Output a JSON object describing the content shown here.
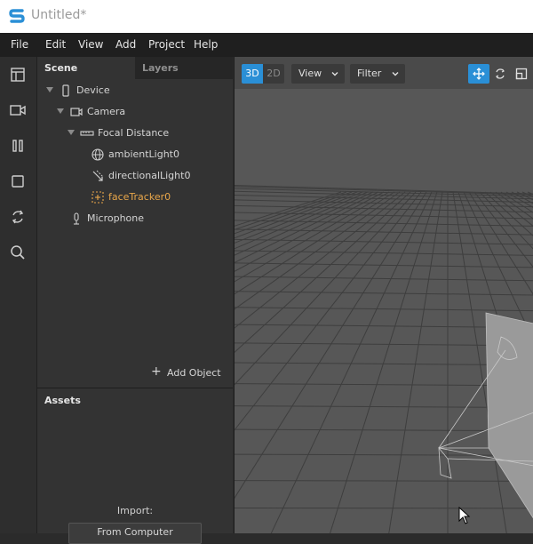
{
  "window": {
    "title": "Untitled*"
  },
  "menu": [
    "File",
    "Edit",
    "View",
    "Add",
    "Project",
    "Help"
  ],
  "rail_icons": [
    "layout-icon",
    "video-camera-icon",
    "pause-icon",
    "square-icon",
    "sync-icon",
    "search-icon"
  ],
  "scene": {
    "tabs": {
      "scene": "Scene",
      "layers": "Layers"
    },
    "tree": [
      {
        "label": "Device",
        "icon": "device-icon",
        "expanded": true
      },
      {
        "label": "Camera",
        "icon": "camera-icon",
        "expanded": true
      },
      {
        "label": "Focal Distance",
        "icon": "focal-distance-icon",
        "expanded": true
      },
      {
        "label": "ambientLight0",
        "icon": "globe-icon",
        "expanded": false
      },
      {
        "label": "directionalLight0",
        "icon": "directional-light-icon",
        "expanded": false
      },
      {
        "label": "faceTracker0",
        "icon": "face-tracker-icon",
        "expanded": false,
        "selected": true
      },
      {
        "label": "Microphone",
        "icon": "microphone-icon",
        "expanded": false
      }
    ],
    "add_object": "Add Object"
  },
  "assets": {
    "title": "Assets",
    "import_label": "Import:",
    "from_computer": "From Computer"
  },
  "viewport": {
    "mode_3d": "3D",
    "mode_2d": "2D",
    "active_mode": "3D",
    "view_label": "View",
    "filter_label": "Filter",
    "tools": [
      "move-icon",
      "rotate-icon",
      "scale-icon"
    ]
  },
  "colors": {
    "accent": "#2a8fd6",
    "selected_text": "#e8a64a",
    "background": "#2b2b2b"
  }
}
